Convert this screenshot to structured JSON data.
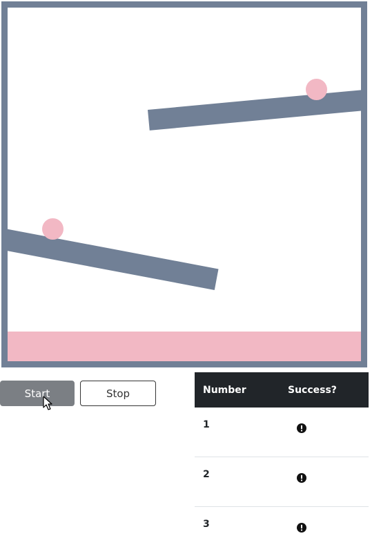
{
  "simulation": {
    "colors": {
      "frame": "#718096",
      "ground": "#f2b8c4",
      "ball": "#f2b8c4",
      "plank": "#718096"
    }
  },
  "controls": {
    "start_label": "Start",
    "stop_label": "Stop"
  },
  "results": {
    "headers": {
      "number": "Number",
      "success": "Success?"
    },
    "rows": [
      {
        "number": "1",
        "status_icon": "exclamation-circle-icon"
      },
      {
        "number": "2",
        "status_icon": "exclamation-circle-icon"
      },
      {
        "number": "3",
        "status_icon": "exclamation-circle-icon"
      }
    ]
  }
}
